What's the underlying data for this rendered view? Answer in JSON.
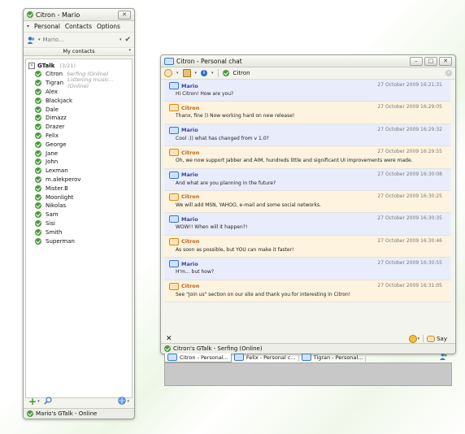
{
  "roster": {
    "title": "Citron - Mario",
    "close_btn": "✕",
    "menu": [
      "Personal",
      "Contacts",
      "Options"
    ],
    "status_name": "Mario...",
    "header": "My contacts",
    "group": {
      "name": "GTalk",
      "count": "(3/21)"
    },
    "contacts": [
      {
        "name": "Citron",
        "status": "Serfing (Online)"
      },
      {
        "name": "Tigran",
        "status": "Listening music... (Online)"
      },
      {
        "name": "Alex",
        "status": ""
      },
      {
        "name": "Blackjack",
        "status": ""
      },
      {
        "name": "Dale",
        "status": ""
      },
      {
        "name": "Dimazz",
        "status": ""
      },
      {
        "name": "Drazer",
        "status": ""
      },
      {
        "name": "Felix",
        "status": ""
      },
      {
        "name": "George",
        "status": ""
      },
      {
        "name": "Jane",
        "status": ""
      },
      {
        "name": "John",
        "status": ""
      },
      {
        "name": "Lexman",
        "status": ""
      },
      {
        "name": "m.alekperov",
        "status": ""
      },
      {
        "name": "Mister.B",
        "status": ""
      },
      {
        "name": "Moonlight",
        "status": ""
      },
      {
        "name": "Nikolas",
        "status": ""
      },
      {
        "name": "Sam",
        "status": ""
      },
      {
        "name": "Sisi",
        "status": ""
      },
      {
        "name": "Smith",
        "status": ""
      },
      {
        "name": "Superman",
        "status": ""
      }
    ],
    "statusbar": "Mario's GTalk - Online"
  },
  "chat": {
    "title": "Citron - Personal chat",
    "contact": "Citron",
    "messages": [
      {
        "from": "Mario",
        "time": "27 October 2009 16:21:31",
        "text": "Hi Citron! How are you?"
      },
      {
        "from": "Citron",
        "time": "27 October 2009 16:29:05",
        "text": "Thanx, fine )) Now working hard on new release!"
      },
      {
        "from": "Mario",
        "time": "27 October 2009 16:29:32",
        "text": "Cool :)) what has changed from v 1.0?"
      },
      {
        "from": "Citron",
        "time": "27 October 2009 16:29:55",
        "text": "Oh, we now support Jabber and AIM, hundreds little and significant UI improvements were made."
      },
      {
        "from": "Mario",
        "time": "27 October 2009 16:30:08",
        "text": "And what are you planning in the future?"
      },
      {
        "from": "Citron",
        "time": "27 October 2009 16:30:25",
        "text": "We will add MSN, YAHOO, e-mail and some social networks."
      },
      {
        "from": "Mario",
        "time": "27 October 2009 16:30:35",
        "text": "WOW!! When will it happen?!"
      },
      {
        "from": "Citron",
        "time": "27 October 2009 16:30:46",
        "text": "As soon as possible, but YOU can make it faster!"
      },
      {
        "from": "Mario",
        "time": "27 October 2009 16:30:55",
        "text": "H'm... but how?"
      },
      {
        "from": "Citron",
        "time": "27 October 2009 16:31:05",
        "text": "See \"Join us\" section on our site and thank you for interesting in Citron!"
      }
    ],
    "tabs": [
      "Citron - Personal...",
      "Felix - Personal c...",
      "Tigran - Personal..."
    ],
    "send_label": "Say",
    "statusbar": "Citron's GTalk - Serfing (Online)"
  },
  "colors": {
    "online": "#4a9a3c",
    "mario": "#3444a8",
    "citron": "#c1621a"
  }
}
